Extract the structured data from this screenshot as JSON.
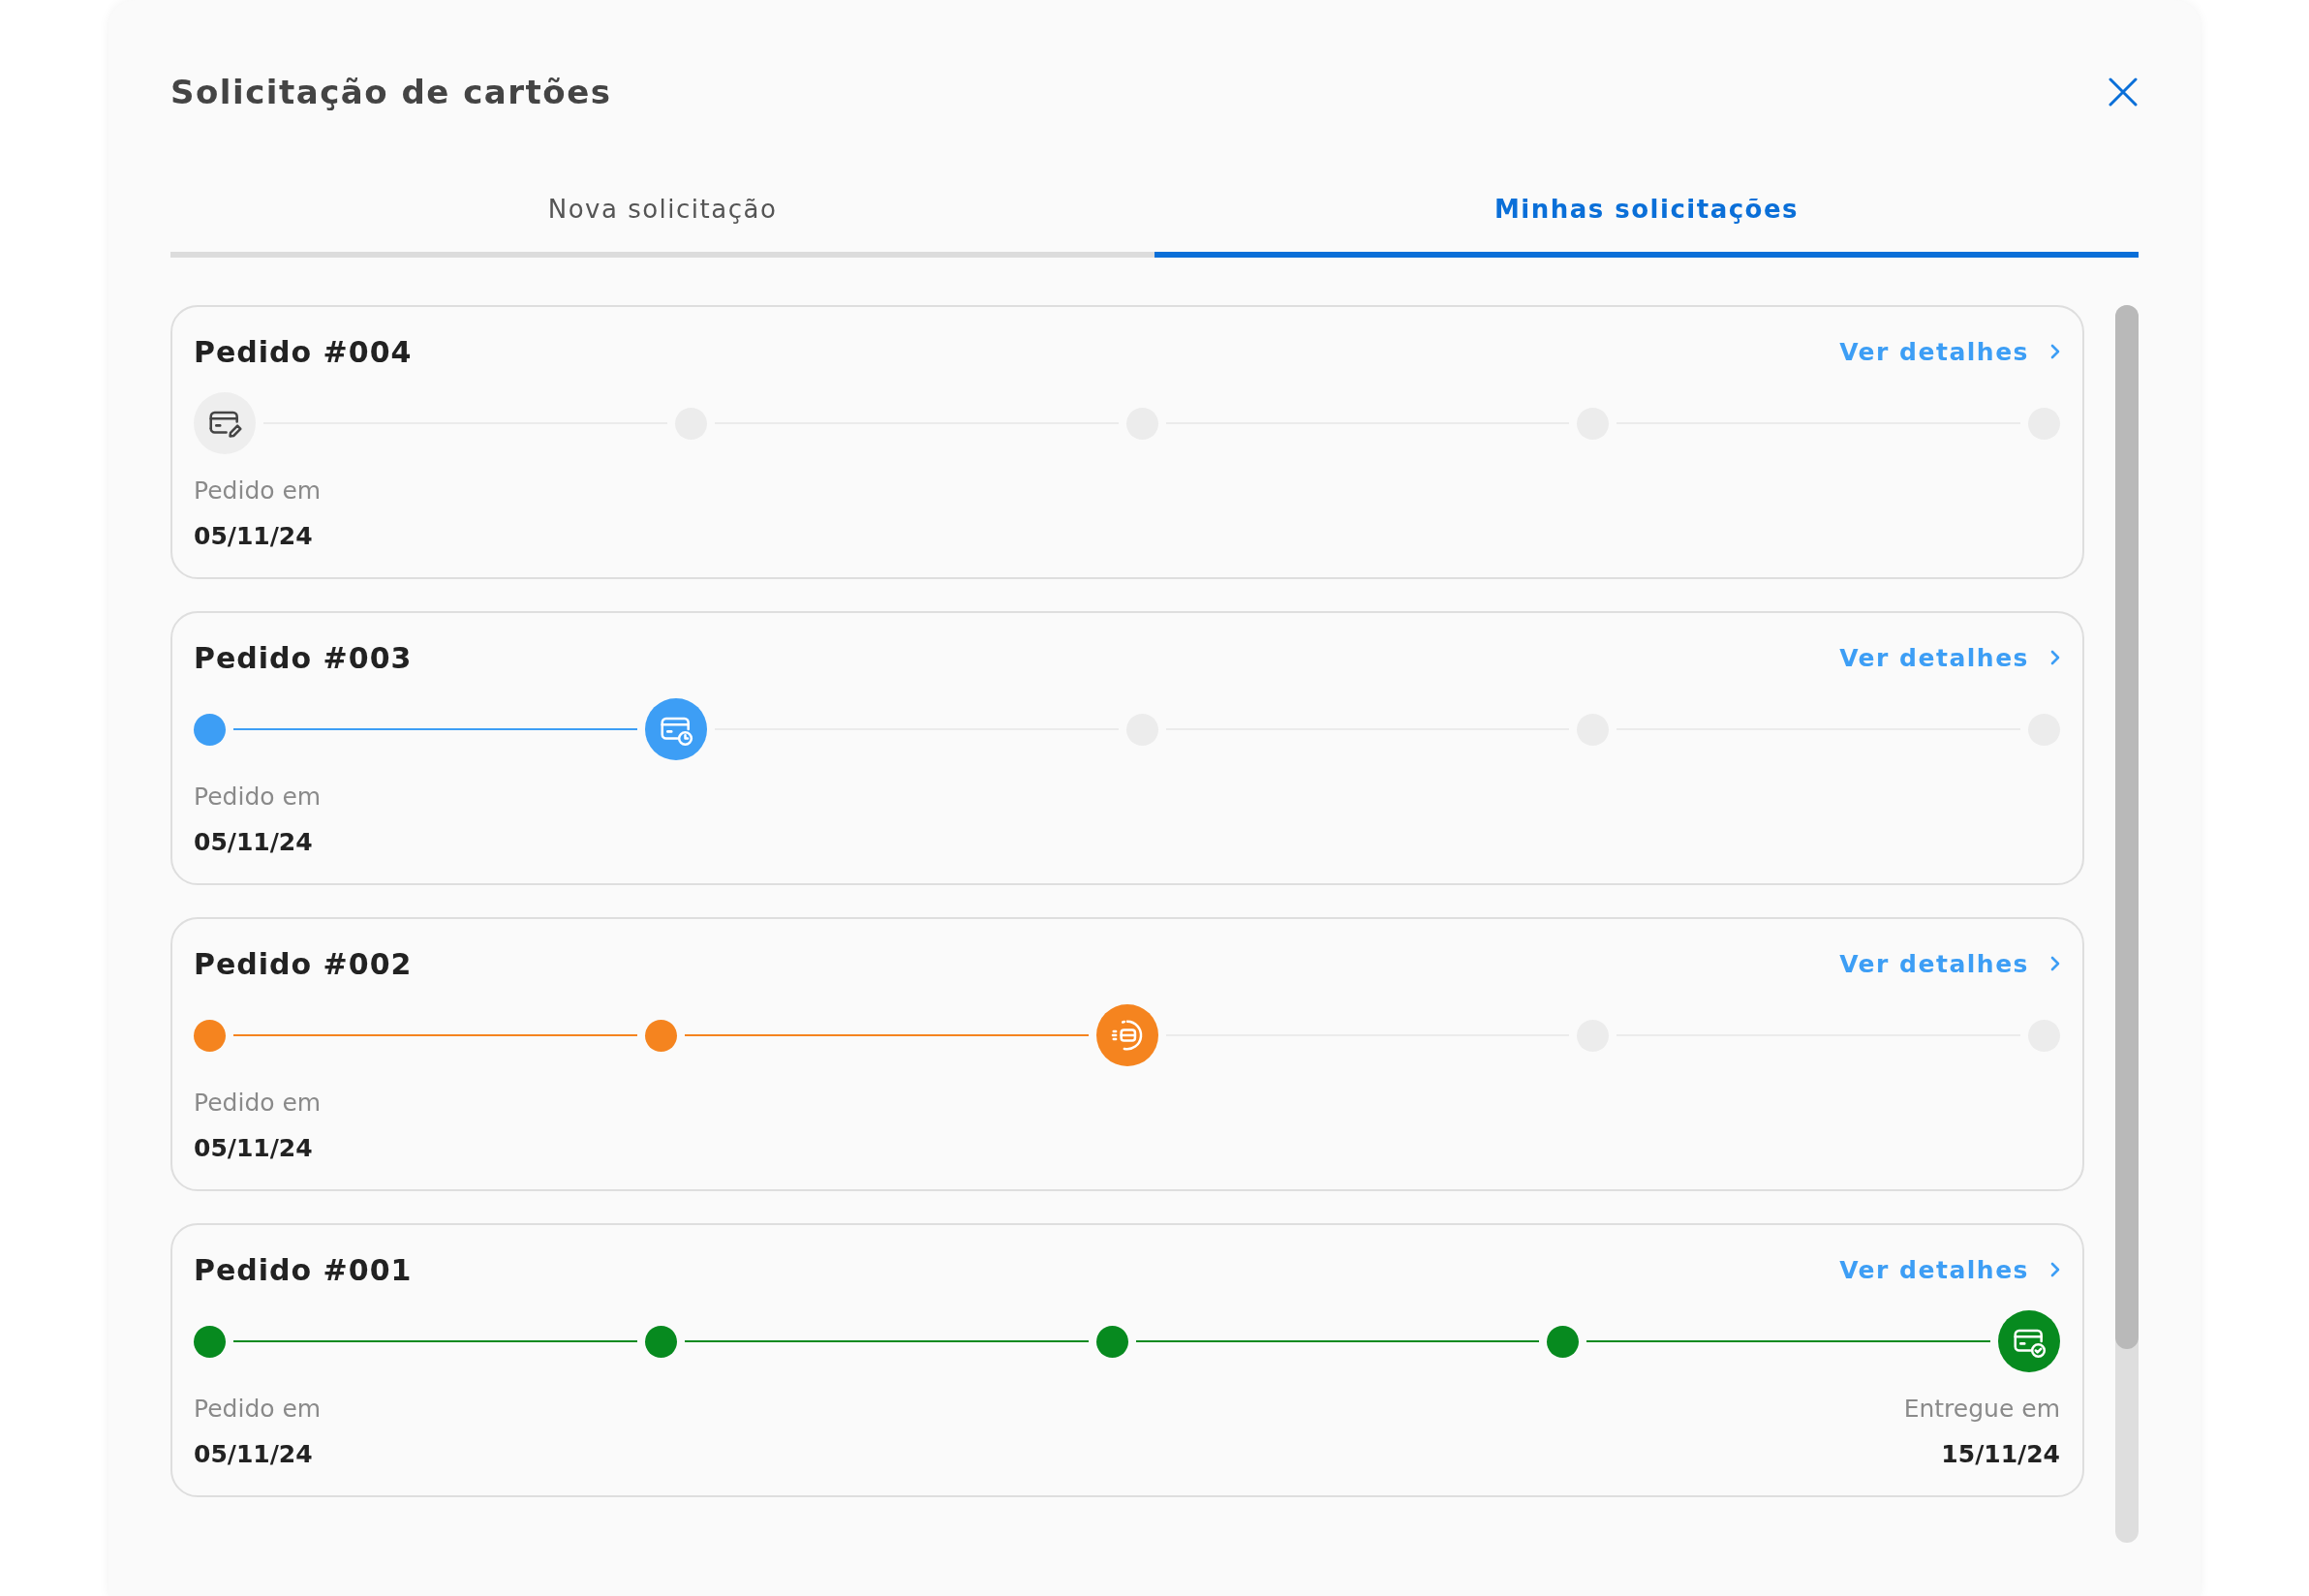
{
  "dialog": {
    "title": "Solicitação de cartões"
  },
  "tabs": [
    {
      "label": "Nova solicitação",
      "selected": false
    },
    {
      "label": "Minhas solicitações",
      "selected": true
    }
  ],
  "orders": [
    {
      "title": "Pedido #004",
      "link": "Ver detalhes",
      "color": "#eeeeee",
      "steps": [
        {
          "kind": "edit"
        },
        {
          "kind": "pending"
        },
        {
          "kind": "pending"
        },
        {
          "kind": "pending"
        },
        {
          "kind": "pending"
        }
      ],
      "ordered_label": "Pedido em",
      "ordered_date": "05/11/24"
    },
    {
      "title": "Pedido #003",
      "link": "Ver detalhes",
      "color": "#3d9ef5",
      "steps": [
        {
          "kind": "done"
        },
        {
          "kind": "clock"
        },
        {
          "kind": "pending"
        },
        {
          "kind": "pending"
        },
        {
          "kind": "pending"
        }
      ],
      "ordered_label": "Pedido em",
      "ordered_date": "05/11/24"
    },
    {
      "title": "Pedido #002",
      "link": "Ver detalhes",
      "color": "#f5841f",
      "steps": [
        {
          "kind": "done"
        },
        {
          "kind": "done"
        },
        {
          "kind": "processing"
        },
        {
          "kind": "pending"
        },
        {
          "kind": "pending"
        }
      ],
      "ordered_label": "Pedido em",
      "ordered_date": "05/11/24"
    },
    {
      "title": "Pedido #001",
      "link": "Ver detalhes",
      "color": "#078a1f",
      "steps": [
        {
          "kind": "done"
        },
        {
          "kind": "done"
        },
        {
          "kind": "done"
        },
        {
          "kind": "done"
        },
        {
          "kind": "check"
        }
      ],
      "ordered_label": "Pedido em",
      "ordered_date": "05/11/24",
      "delivered_label": "Entregue em",
      "delivered_date": "15/11/24"
    }
  ]
}
